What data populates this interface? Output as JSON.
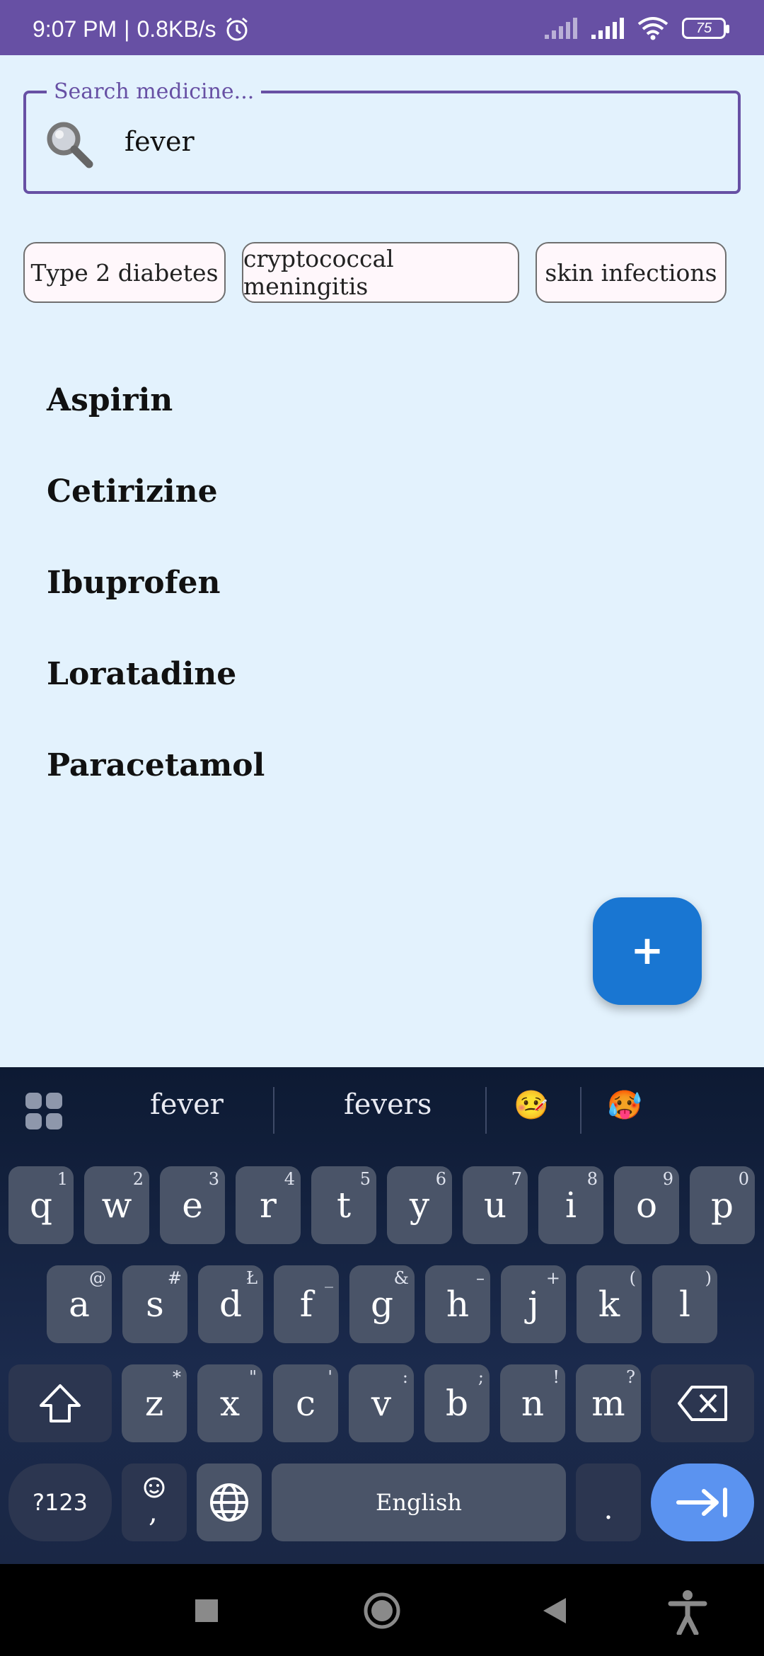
{
  "status_bar": {
    "time": "9:07 PM",
    "speed": "0.8KB/s",
    "battery": "75"
  },
  "search": {
    "label": "Search medicine...",
    "value": "fever"
  },
  "chips": [
    "Type 2 diabetes",
    "cryptococcal meningitis",
    "skin infections"
  ],
  "results": [
    "Aspirin",
    "Cetirizine",
    "Ibuprofen",
    "Loratadine",
    "Paracetamol"
  ],
  "fab": {
    "label": "+"
  },
  "keyboard": {
    "suggestions": [
      "fever",
      "fevers"
    ],
    "emoji_suggestions": [
      "🤒",
      "🥵"
    ],
    "row1": [
      {
        "k": "q",
        "h": "1"
      },
      {
        "k": "w",
        "h": "2"
      },
      {
        "k": "e",
        "h": "3"
      },
      {
        "k": "r",
        "h": "4"
      },
      {
        "k": "t",
        "h": "5"
      },
      {
        "k": "y",
        "h": "6"
      },
      {
        "k": "u",
        "h": "7"
      },
      {
        "k": "i",
        "h": "8"
      },
      {
        "k": "o",
        "h": "9"
      },
      {
        "k": "p",
        "h": "0"
      }
    ],
    "row2": [
      {
        "k": "a",
        "h": "@"
      },
      {
        "k": "s",
        "h": "#"
      },
      {
        "k": "d",
        "h": "Ł"
      },
      {
        "k": "f",
        "h": "_"
      },
      {
        "k": "g",
        "h": "&"
      },
      {
        "k": "h",
        "h": "–"
      },
      {
        "k": "j",
        "h": "+"
      },
      {
        "k": "k",
        "h": "("
      },
      {
        "k": "l",
        "h": ")"
      }
    ],
    "row3": [
      {
        "k": "z",
        "h": "*"
      },
      {
        "k": "x",
        "h": "\""
      },
      {
        "k": "c",
        "h": "'"
      },
      {
        "k": "v",
        "h": ":"
      },
      {
        "k": "b",
        "h": ";"
      },
      {
        "k": "n",
        "h": "!"
      },
      {
        "k": "m",
        "h": "?"
      }
    ],
    "symbols_label": "?123",
    "comma_label": ",",
    "space_label": "English",
    "period_label": "."
  },
  "colors": {
    "primary": "#6750A4",
    "background": "#E3F2FD",
    "fab": "#1976D2",
    "enter_key": "#5B93F0"
  }
}
